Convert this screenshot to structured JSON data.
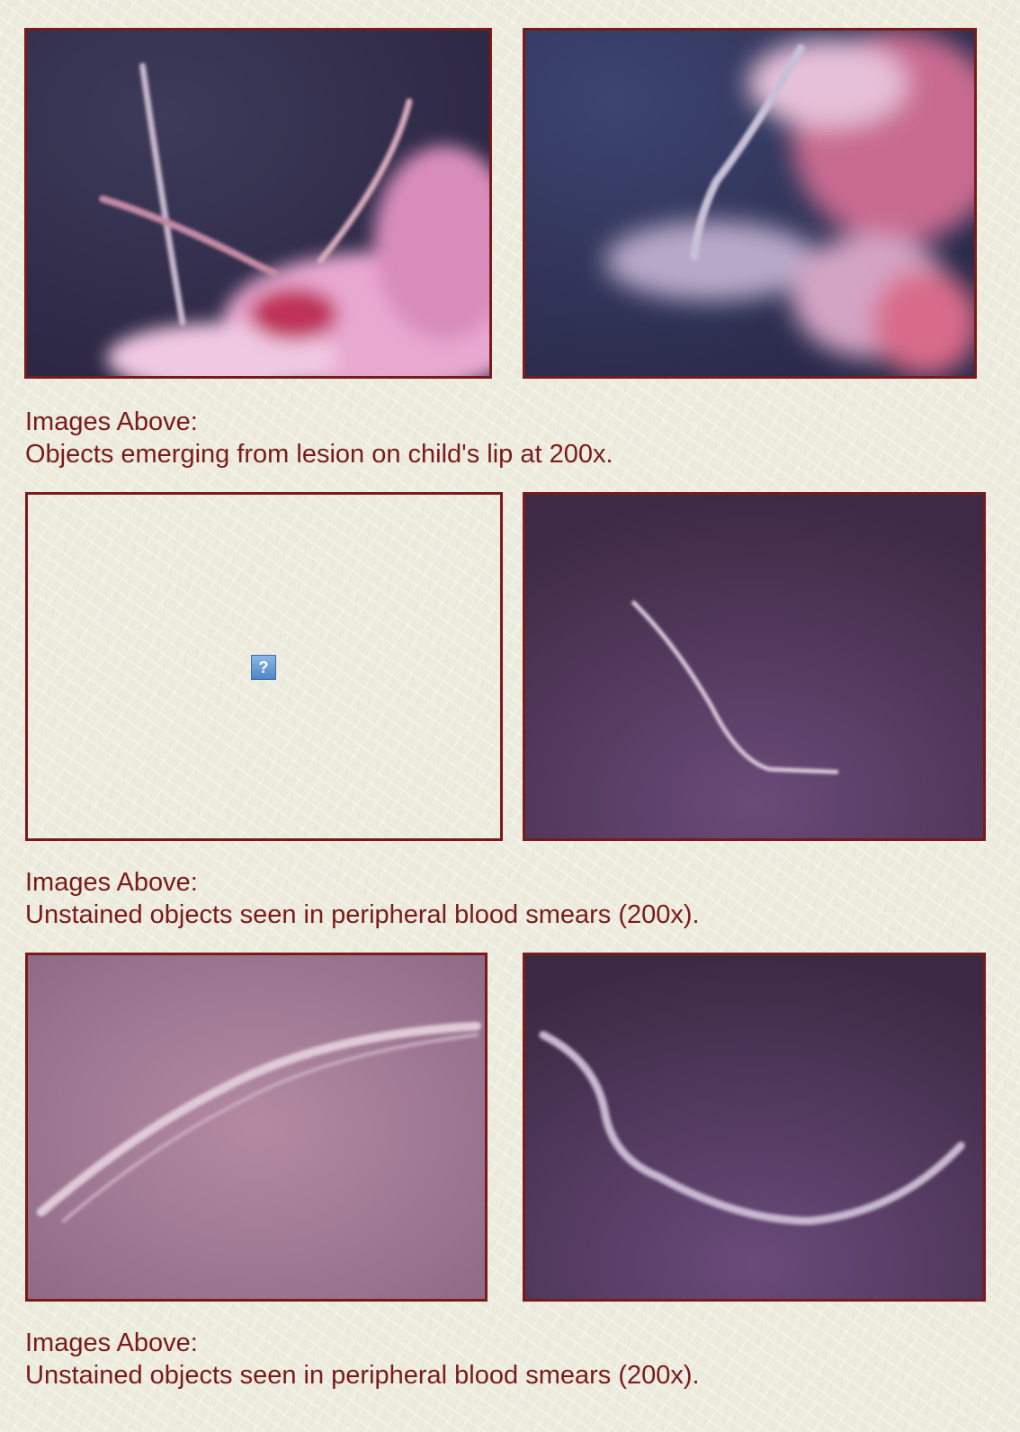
{
  "rows": [
    {
      "caption_heading": "Images Above:",
      "caption_text": "Objects emerging from lesion on child's lip at 200x."
    },
    {
      "caption_heading": "Images Above:",
      "caption_text": "Unstained objects seen in peripheral blood smears (200x)."
    },
    {
      "caption_heading": "Images Above:",
      "caption_text": "Unstained objects seen in peripheral blood smears (200x)."
    }
  ],
  "broken_image_icon": "broken-image-question-icon",
  "colors": {
    "caption_text": "#7a1a1a",
    "photo_border": "#7a1a1a",
    "background": "#ecebdd"
  }
}
